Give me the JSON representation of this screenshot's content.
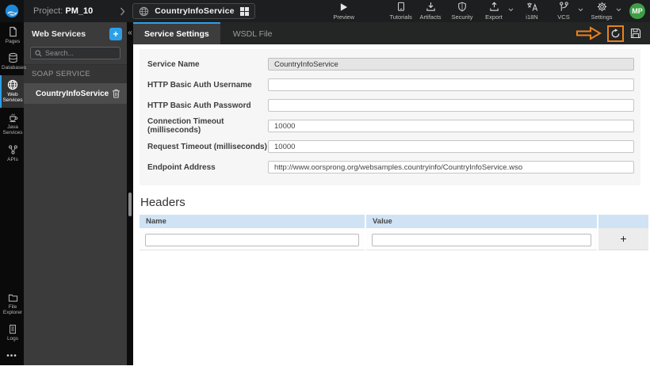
{
  "colors": {
    "accent_blue": "#2d9fe8",
    "annotation_orange": "#e8821d",
    "avatar_green": "#3f9d46",
    "table_header_blue": "#cfe3f4"
  },
  "topbar": {
    "project_label": "Project:",
    "project_name": "PM_10",
    "service_name": "CountryInfoService",
    "preview_label": "Preview",
    "tutorials_label": "Tutorials",
    "artifacts_label": "Artifacts",
    "security_label": "Security",
    "export_label": "Export",
    "i18n_label": "i18N",
    "vcs_label": "VCS",
    "settings_label": "Settings",
    "avatar_initials": "MP"
  },
  "sidebar": {
    "items": [
      {
        "label": "Pages"
      },
      {
        "label": "Databases"
      },
      {
        "label": "Web Services"
      },
      {
        "label": "Java Services"
      },
      {
        "label": "APIs"
      }
    ],
    "file_explorer_label": "File Explorer",
    "logs_label": "Logs",
    "more_glyph": "•••"
  },
  "panel": {
    "title": "Web Services",
    "add_button": "+",
    "collapse_glyph": "«",
    "search_placeholder": "Search...",
    "section_label": "SOAP SERVICE",
    "service_item": "CountryInfoService"
  },
  "tabs": {
    "service_settings": "Service Settings",
    "wsdl_file": "WSDL File"
  },
  "form": {
    "fields": [
      {
        "label": "Service Name",
        "value": "CountryInfoService"
      },
      {
        "label": "HTTP Basic Auth Username",
        "value": ""
      },
      {
        "label": "HTTP Basic Auth Password",
        "value": ""
      },
      {
        "label": "Connection Timeout (milliseconds)",
        "value": "10000"
      },
      {
        "label": "Request Timeout (milliseconds)",
        "value": "10000"
      },
      {
        "label": "Endpoint Address",
        "value": "http://www.oorsprong.org/websamples.countryinfo/CountryInfoService.wso"
      }
    ]
  },
  "headers_section": {
    "title": "Headers",
    "columns": [
      "Name",
      "Value"
    ],
    "add_button": "+"
  }
}
